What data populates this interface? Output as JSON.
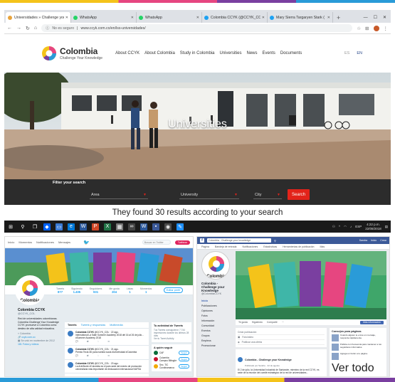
{
  "browser": {
    "tabs": [
      {
        "label": "Universidades » Challenge you...",
        "color": "#e8a33a",
        "active": true
      },
      {
        "label": "WhatsApp",
        "color": "#25d366",
        "active": false
      },
      {
        "label": "WhatsApp",
        "color": "#25d366",
        "active": false
      },
      {
        "label": "Colombia CCYK (@CCYK_COL)",
        "color": "#1da1f2",
        "active": false
      },
      {
        "label": "Mary Sierra Targaryen Stark (",
        "color": "#1da1f2",
        "active": false
      }
    ],
    "new_tab": "+",
    "insecure_label": "No es seguro",
    "url": "www.ccyk.com.co/en/lss-universidades/"
  },
  "site": {
    "logo_name": "Colombia",
    "logo_tagline": "Challenge Your Knowledge",
    "nav": [
      "About CCYK",
      "About Colombia",
      "Study in Colombia",
      "Universities",
      "News",
      "Events",
      "Documents"
    ],
    "lang_es": "ES",
    "lang_en": "EN",
    "hero_title": "Universities",
    "filter_label": "Filter your search",
    "filters": [
      {
        "label": "Area",
        "key": "area"
      },
      {
        "label": "University",
        "key": "university"
      },
      {
        "label": "City",
        "key": "city"
      }
    ],
    "search_button": "Search",
    "results_text": "They found 30 results according to your search"
  },
  "taskbar": {
    "lang": "ESP",
    "time": "4:22 p.m.",
    "date": "22/08/2018"
  },
  "twitter": {
    "nav": [
      "Inicio",
      "Momentos",
      "Notificaciones",
      "Mensajes"
    ],
    "search_placeholder": "Buscar en Twitter",
    "tweet_button": "Twittear",
    "stats": [
      {
        "label": "Tweets",
        "value": "877"
      },
      {
        "label": "Siguiendo",
        "value": "1.405"
      },
      {
        "label": "Seguidores",
        "value": "931"
      },
      {
        "label": "Me gusta",
        "value": "204"
      },
      {
        "label": "Listas",
        "value": "1"
      },
      {
        "label": "Momentos",
        "value": "1"
      }
    ],
    "edit_profile": "Editar perfil",
    "profile_name": "Colombia CCYK",
    "profile_handle": "@CCYK_COL",
    "bio": "Red de universidades colombianas. Colombia Challenge Your Knowledge CCYK promueve a Colombia como destino de alta calidad educativa.",
    "location": "Colombia",
    "link": "ccyk.com.co",
    "joined": "Se unió en noviembre de 2012",
    "photos_label": "181 Fotos y videos",
    "feed_tabs": [
      "Tweets",
      "Tweets y respuestas",
      "Multimedia"
    ],
    "tweets": [
      {
        "author": "Colombia CCYK",
        "handle": "@CCYK_COL · 22 ago.",
        "text": "International La Salle Summer Academy 2018 del 16 al 26 de julio... #Summer Academy 2018"
      },
      {
        "author": "Colombia CCYK",
        "handle": "@CCYK_COL · 21 ago.",
        "text": "Premio Tecla 3D para nuestra socia #Universidad #Colombia"
      },
      {
        "author": "Colombia CCYK",
        "handle": "@CCYK_COL · 20 ago.",
        "text": "La #UniNorte #Colombia es el país sede del evento de promoción universitaria más importante de #educación internacional NAFSA"
      }
    ],
    "activity_title": "Tu actividad de Tweets",
    "activity_text": "Tus Tweets consiguieron 7.744 impresiones durante los últimos 28 días",
    "activity_link": "Ver tu Tweet Activity",
    "who_title": "A quién seguir",
    "who": [
      {
        "name": "CAF",
        "color": "#0a6e3a"
      },
      {
        "name": "Colombia Campus Bilingüe",
        "color": "#c8102e"
      },
      {
        "name": "Sec. TIC Cundinamarca",
        "color": "#f2a900"
      }
    ],
    "follow_label": "Seguir"
  },
  "facebook": {
    "search_placeholder": "Colombia - Challenge your knowledge",
    "topright": [
      "Sandra",
      "Inicio",
      "Crear"
    ],
    "subnav": [
      "Página",
      "Bandeja de entrada",
      "Notificaciones",
      "Estadísticas",
      "Herramientas de publicación",
      "Más"
    ],
    "page_name": "Colombia - Challenge your Knowledge",
    "page_handle": "@ColombiaCCYK",
    "left_nav": [
      "Inicio",
      "Publicaciones",
      "Opiniones",
      "Fotos",
      "Información",
      "Comunidad",
      "Eventos",
      "Grupos",
      "Empleos",
      "Promocionar"
    ],
    "actions": [
      "Te gusta",
      "Siguiendo",
      "Compartir",
      "···"
    ],
    "learn_more": "Más información",
    "create_post_rows": [
      "Crear publicación",
      "Foto/video",
      "Publicar una oferta"
    ],
    "post_author": "Colombia - Challenge your Knowledge",
    "post_meta": "Publicado por Sandra · 22 de agosto",
    "post_text": "El 2 de julio, la Universidad Industrial de Santander, miembro de la red CCYK, es sede de la reunión del comité estratégico de la red de universidades...",
    "suggested_title": "Consejos para páginas",
    "suggestions": [
      "Cuando alguien te envíe un mensaje, responde rápidamente.",
      "Publica con frecuencia para mantener a tus seguidores informados.",
      "Agrega un botón a tu página."
    ],
    "suggestion_button": "Ver todo"
  }
}
